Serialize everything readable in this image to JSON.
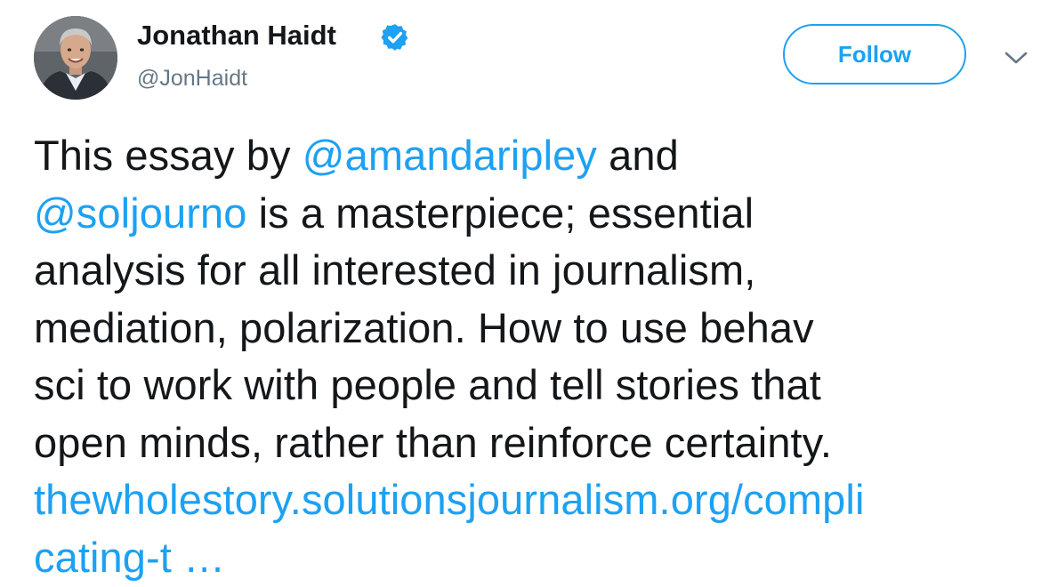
{
  "author": {
    "name": "Jonathan Haidt",
    "handle": "@JonHaidt",
    "verified_icon": "verified-badge-icon",
    "avatar_icon": "profile-avatar"
  },
  "actions": {
    "follow_label": "Follow",
    "menu_icon": "chevron-down-icon"
  },
  "tweet": {
    "segments": {
      "t1": "This essay by ",
      "mention1": "@amandaripley",
      "t2": " and",
      "mention2": "@soljourno",
      "t3": " is a masterpiece; essential",
      "t4": "analysis for all interested in journalism,",
      "t5": "mediation, polarization. How to use behav",
      "t6": "sci to work with people and tell stories that",
      "t7": "open minds, rather than reinforce certainty.",
      "link_part1": "thewholestory.solutionsjournalism.org/compli",
      "link_part2": "cating-t …"
    }
  },
  "colors": {
    "accent": "#1da1f2",
    "text": "#14171a",
    "secondary": "#657786"
  }
}
